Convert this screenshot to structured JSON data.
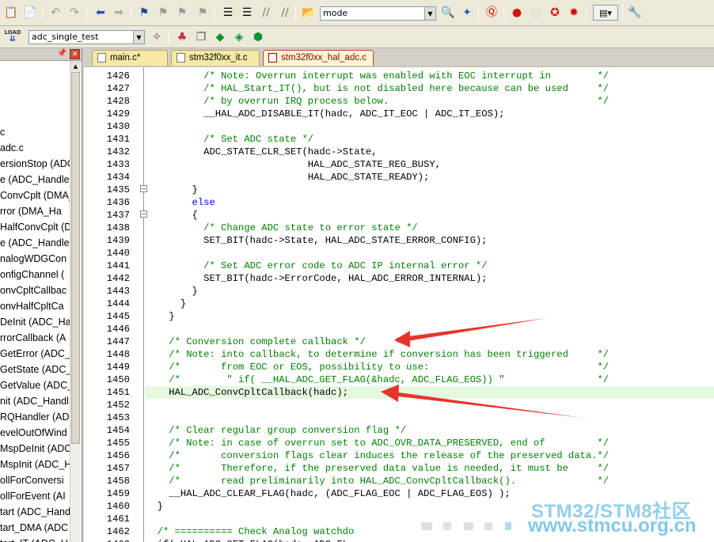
{
  "toolbar1": {
    "mode_value": "mode",
    "icons": [
      "paste-icon",
      "copy-icon",
      "undo-icon",
      "redo-icon",
      "back-icon",
      "forward-icon",
      "bookmark-icon",
      "prev-bookmark-icon",
      "next-bookmark-icon",
      "clear-bookmarks-icon",
      "indent-icon",
      "unindent-icon",
      "comment-icon",
      "uncomment-icon",
      "find-in-files-icon",
      "find-icon",
      "debug-icon",
      "breakpoint-icon",
      "disable-breakpoint-icon",
      "kill-breakpoints-icon",
      "clear-breakpoints-icon",
      "window-icon",
      "settings-icon"
    ]
  },
  "toolbar2": {
    "load_label": "LOAD",
    "target_value": "adc_single_test"
  },
  "tabs": [
    {
      "label": "main.c*",
      "active": false
    },
    {
      "label": "stm32f0xx_it.c",
      "active": false
    },
    {
      "label": "stm32f0xx_hal_adc.c",
      "active": true
    }
  ],
  "left_panel": {
    "items": [
      "",
      "",
      "",
      "",
      "c",
      "adc.c",
      "ersionStop (ADC",
      "e (ADC_Handle",
      "ConvCplt (DMA_",
      "rror (DMA_Ha",
      "HalfConvCplt (D",
      "e (ADC_Handle",
      "nalogWDGCon",
      "onfigChannel (",
      "onvCpltCallbac",
      "onvHalfCpltCa",
      "DeInit (ADC_Han",
      "rrorCallback (A",
      "GetError (ADC_l",
      "GetState (ADC_l",
      "GetValue (ADC_",
      "nit (ADC_Handl",
      "RQHandler (AD",
      "evelOutOfWind",
      "MspDeInit (ADC",
      "MspInit (ADC_H",
      "ollForConversi",
      "ollForEvent (AI",
      "tart (ADC_Hand",
      "tart_DMA (ADC",
      "tart_IT (ADC_H"
    ]
  },
  "code": {
    "lines": [
      {
        "n": "1426",
        "t": "          /* Note: Overrun interrupt was enabled with EOC interrupt in        */",
        "k": "comment"
      },
      {
        "n": "1427",
        "t": "          /* HAL_Start_IT(), but is not disabled here because can be used     */",
        "k": "comment"
      },
      {
        "n": "1428",
        "t": "          /* by overrun IRQ process below.                                    */",
        "k": "comment"
      },
      {
        "n": "1429",
        "t": "          __HAL_ADC_DISABLE_IT(hadc, ADC_IT_EOC | ADC_IT_EOS);",
        "k": "code"
      },
      {
        "n": "1430",
        "t": "",
        "k": "code"
      },
      {
        "n": "1431",
        "t": "          /* Set ADC state */",
        "k": "comment"
      },
      {
        "n": "1432",
        "t": "          ADC_STATE_CLR_SET(hadc->State,",
        "k": "code"
      },
      {
        "n": "1433",
        "t": "                            HAL_ADC_STATE_REG_BUSY,",
        "k": "code"
      },
      {
        "n": "1434",
        "t": "                            HAL_ADC_STATE_READY);",
        "k": "code"
      },
      {
        "n": "1435",
        "t": "        }",
        "k": "code"
      },
      {
        "n": "1436",
        "t": "        else",
        "k": "kw"
      },
      {
        "n": "1437",
        "t": "        {",
        "k": "code"
      },
      {
        "n": "1438",
        "t": "          /* Change ADC state to error state */",
        "k": "comment"
      },
      {
        "n": "1439",
        "t": "          SET_BIT(hadc->State, HAL_ADC_STATE_ERROR_CONFIG);",
        "k": "code"
      },
      {
        "n": "1440",
        "t": "",
        "k": "code"
      },
      {
        "n": "1441",
        "t": "          /* Set ADC error code to ADC IP internal error */",
        "k": "comment"
      },
      {
        "n": "1442",
        "t": "          SET_BIT(hadc->ErrorCode, HAL_ADC_ERROR_INTERNAL);",
        "k": "code"
      },
      {
        "n": "1443",
        "t": "        }",
        "k": "code"
      },
      {
        "n": "1444",
        "t": "      }",
        "k": "code"
      },
      {
        "n": "1445",
        "t": "    }",
        "k": "code"
      },
      {
        "n": "1446",
        "t": "",
        "k": "code"
      },
      {
        "n": "1447",
        "t": "    /* Conversion complete callback */",
        "k": "comment"
      },
      {
        "n": "1448",
        "t": "    /* Note: into callback, to determine if conversion has been triggered     */",
        "k": "comment"
      },
      {
        "n": "1449",
        "t": "    /*       from EOC or EOS, possibility to use:                             */",
        "k": "comment"
      },
      {
        "n": "1450",
        "t": "    /*        \" if( __HAL_ADC_GET_FLAG(&hadc, ADC_FLAG_EOS)) \"                */",
        "k": "comment"
      },
      {
        "n": "1451",
        "t": "    HAL_ADC_ConvCpltCallback(hadc);",
        "k": "code",
        "highlight": true
      },
      {
        "n": "1452",
        "t": "",
        "k": "code"
      },
      {
        "n": "1453",
        "t": "",
        "k": "code"
      },
      {
        "n": "1454",
        "t": "    /* Clear regular group conversion flag */",
        "k": "comment"
      },
      {
        "n": "1455",
        "t": "    /* Note: in case of overrun set to ADC_OVR_DATA_PRESERVED, end of         */",
        "k": "comment"
      },
      {
        "n": "1456",
        "t": "    /*       conversion flags clear induces the release of the preserved data.*/",
        "k": "comment"
      },
      {
        "n": "1457",
        "t": "    /*       Therefore, if the preserved data value is needed, it must be     */",
        "k": "comment"
      },
      {
        "n": "1458",
        "t": "    /*       read preliminarily into HAL_ADC_ConvCpltCallback().              */",
        "k": "comment"
      },
      {
        "n": "1459",
        "t": "    __HAL_ADC_CLEAR_FLAG(hadc, (ADC_FLAG_EOC | ADC_FLAG_EOS) );",
        "k": "code"
      },
      {
        "n": "1460",
        "t": "  }",
        "k": "code"
      },
      {
        "n": "1461",
        "t": "",
        "k": "code"
      },
      {
        "n": "1462",
        "t": "  /* ========== Check Analog watchdo",
        "k": "comment"
      },
      {
        "n": "1463",
        "t": "  if( HAL_ADC_GET_FLAG(hadc, ADC_FL",
        "k": "code"
      }
    ]
  },
  "watermark": {
    "line1": "STM32/STM8社区",
    "line2": "www.stmcu.org.cn"
  },
  "colors": {
    "comment": "#008000",
    "keyword": "#0000ff",
    "highlight_line": "#e6f9e0",
    "arrow": "#e8332a"
  }
}
